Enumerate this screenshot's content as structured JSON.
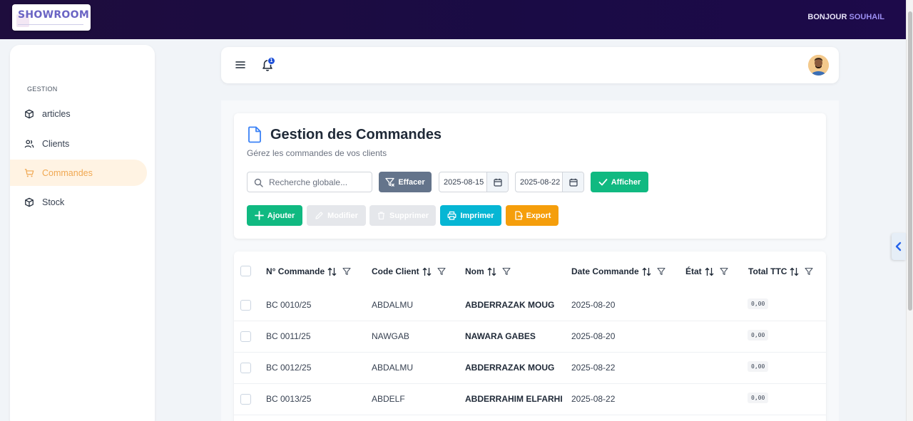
{
  "brand": {
    "logo_text": "SHOWROOM",
    "greeting_prefix": "BONJOUR",
    "user_name": "SOUHAIL"
  },
  "sidebar": {
    "section_label": "GESTION",
    "items": [
      {
        "label": "articles",
        "icon": "cube-icon",
        "active": false
      },
      {
        "label": "Clients",
        "icon": "users-icon",
        "active": false
      },
      {
        "label": "Commandes",
        "icon": "cart-icon",
        "active": true
      },
      {
        "label": "Stock",
        "icon": "cube-icon",
        "active": false
      }
    ]
  },
  "header": {
    "notification_count": "1"
  },
  "page": {
    "title": "Gestion des Commandes",
    "subtitle": "Gérez les commandes de vos clients",
    "search_placeholder": "Recherche globale...",
    "clear_label": "Effacer",
    "date_from": "2025-08-15",
    "date_to": "2025-08-22",
    "show_label": "Afficher",
    "actions": {
      "add": "Ajouter",
      "edit": "Modifier",
      "delete": "Supprimer",
      "print": "Imprimer",
      "export": "Export"
    }
  },
  "table": {
    "columns": [
      "N° Commande",
      "Code Client",
      "Nom",
      "Date Commande",
      "État",
      "Total TTC"
    ],
    "rows": [
      {
        "num": "BC 0010/25",
        "code": "ABDALMU",
        "nom": "ABDERRAZAK MOUG",
        "date": "2025-08-20",
        "etat": "",
        "total": "0,00"
      },
      {
        "num": "BC 0011/25",
        "code": "NAWGAB",
        "nom": "NAWARA GABES",
        "date": "2025-08-20",
        "etat": "",
        "total": "0,00"
      },
      {
        "num": "BC 0012/25",
        "code": "ABDALMU",
        "nom": "ABDERRAZAK MOUG",
        "date": "2025-08-22",
        "etat": "",
        "total": "0,00"
      },
      {
        "num": "BC 0013/25",
        "code": "ABDELF",
        "nom": "ABDERRAHIM ELFARHI",
        "date": "2025-08-22",
        "etat": "",
        "total": "0,00"
      }
    ]
  },
  "colors": {
    "topbar": "#1a0b45",
    "accent_green": "#10b981",
    "accent_cyan": "#06b6d4",
    "accent_orange": "#f59e0b",
    "active_nav": "#f0a852",
    "clear_button": "#64748b"
  }
}
